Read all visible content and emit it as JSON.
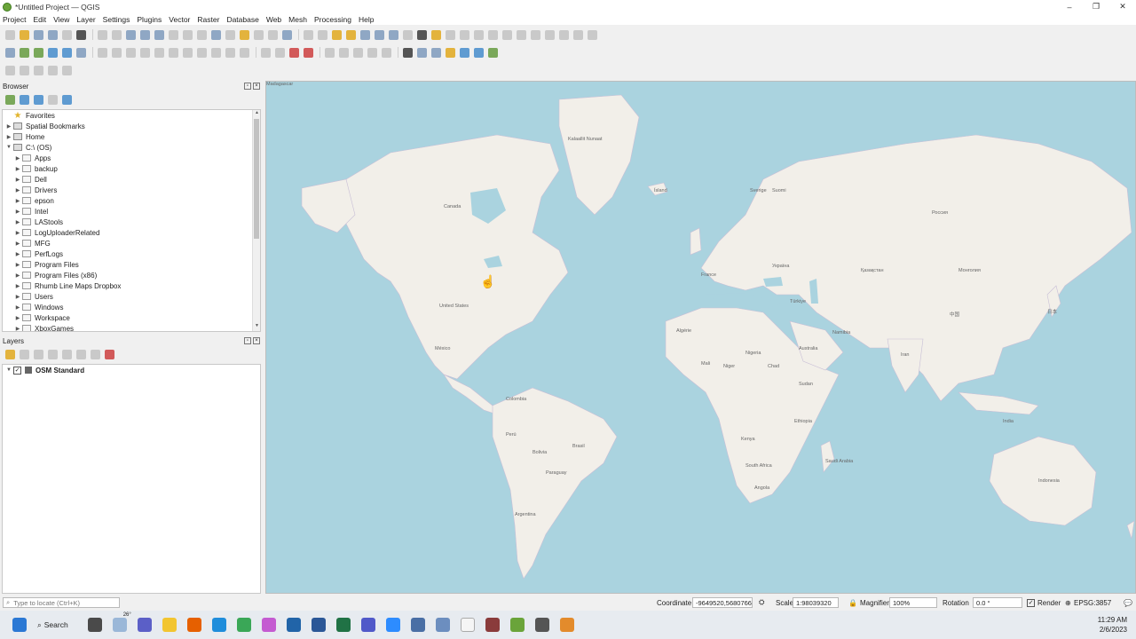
{
  "window": {
    "title": "*Untitled Project — QGIS",
    "controls": [
      "–",
      "❐",
      "✕"
    ]
  },
  "menu": [
    "Project",
    "Edit",
    "View",
    "Layer",
    "Settings",
    "Plugins",
    "Vector",
    "Raster",
    "Database",
    "Web",
    "Mesh",
    "Processing",
    "Help"
  ],
  "browser": {
    "title": "Browser",
    "items": [
      {
        "label": "Favorites",
        "icon": "star-icon",
        "level": 0,
        "expander": ""
      },
      {
        "label": "Spatial Bookmarks",
        "icon": "bookmark-icon",
        "level": 0,
        "expander": "▶"
      },
      {
        "label": "Home",
        "icon": "home-icon",
        "level": 0,
        "expander": "▶"
      },
      {
        "label": "C:\\ (OS)",
        "icon": "drive-icon",
        "level": 0,
        "expander": "▼"
      },
      {
        "label": "Apps",
        "icon": "folder-icon",
        "level": 1,
        "expander": "▶"
      },
      {
        "label": "backup",
        "icon": "folder-icon",
        "level": 1,
        "expander": "▶"
      },
      {
        "label": "Dell",
        "icon": "folder-icon",
        "level": 1,
        "expander": "▶"
      },
      {
        "label": "Drivers",
        "icon": "folder-icon",
        "level": 1,
        "expander": "▶"
      },
      {
        "label": "epson",
        "icon": "folder-icon",
        "level": 1,
        "expander": "▶"
      },
      {
        "label": "Intel",
        "icon": "folder-icon",
        "level": 1,
        "expander": "▶"
      },
      {
        "label": "LAStools",
        "icon": "folder-icon",
        "level": 1,
        "expander": "▶"
      },
      {
        "label": "LogUploaderRelated",
        "icon": "folder-icon",
        "level": 1,
        "expander": "▶"
      },
      {
        "label": "MFG",
        "icon": "folder-icon",
        "level": 1,
        "expander": "▶"
      },
      {
        "label": "PerfLogs",
        "icon": "folder-icon",
        "level": 1,
        "expander": "▶"
      },
      {
        "label": "Program Files",
        "icon": "folder-icon",
        "level": 1,
        "expander": "▶"
      },
      {
        "label": "Program Files (x86)",
        "icon": "folder-icon",
        "level": 1,
        "expander": "▶"
      },
      {
        "label": "Rhumb Line Maps Dropbox",
        "icon": "folder-icon",
        "level": 1,
        "expander": "▶"
      },
      {
        "label": "Users",
        "icon": "folder-icon",
        "level": 1,
        "expander": "▶"
      },
      {
        "label": "Windows",
        "icon": "folder-icon",
        "level": 1,
        "expander": "▶"
      },
      {
        "label": "Workspace",
        "icon": "folder-icon",
        "level": 1,
        "expander": "▶"
      },
      {
        "label": "XboxGames",
        "icon": "folder-icon",
        "level": 1,
        "expander": "▶"
      }
    ]
  },
  "layers": {
    "title": "Layers",
    "items": [
      {
        "label": "OSM Standard",
        "checked": true
      }
    ]
  },
  "map": {
    "labels": [
      "Kalaallit Nunaat",
      "Canada",
      "United States",
      "México",
      "Colombia",
      "Perú",
      "Brasil",
      "Bolivia",
      "Paraguay",
      "Argentina",
      "Ísland",
      "Sverige",
      "Suomi",
      "France",
      "Україна",
      "Türkiye",
      "Россия",
      "Қазақстан",
      "Монголия",
      "中国",
      "日本",
      "Algérie",
      "Mali",
      "Niger",
      "Nigeria",
      "Chad",
      "Sudan",
      "Ethiopia",
      "Kenya",
      "Angola",
      "South Africa",
      "Namibia",
      "Iran",
      "India",
      "Indonesia",
      "Australia",
      "Saudi Arabia",
      "Madagascar"
    ]
  },
  "status": {
    "locate_placeholder": "Type to locate (Ctrl+K)",
    "coordinate_label": "Coordinate",
    "coordinate_value": "-9649520,5680766",
    "scale_label": "Scale",
    "scale_value": "1:98039320",
    "magnifier_label": "Magnifier",
    "magnifier_value": "100%",
    "rotation_label": "Rotation",
    "rotation_value": "0.0 °",
    "render_label": "Render",
    "crs": "EPSG:3857"
  },
  "taskbar": {
    "search_label": "Search",
    "weather": "26°",
    "time": "11:29 AM",
    "date": "2/6/2023"
  },
  "colors": {
    "water": "#aad3df",
    "land": "#f2efe9",
    "border": "#b9a9c9"
  }
}
